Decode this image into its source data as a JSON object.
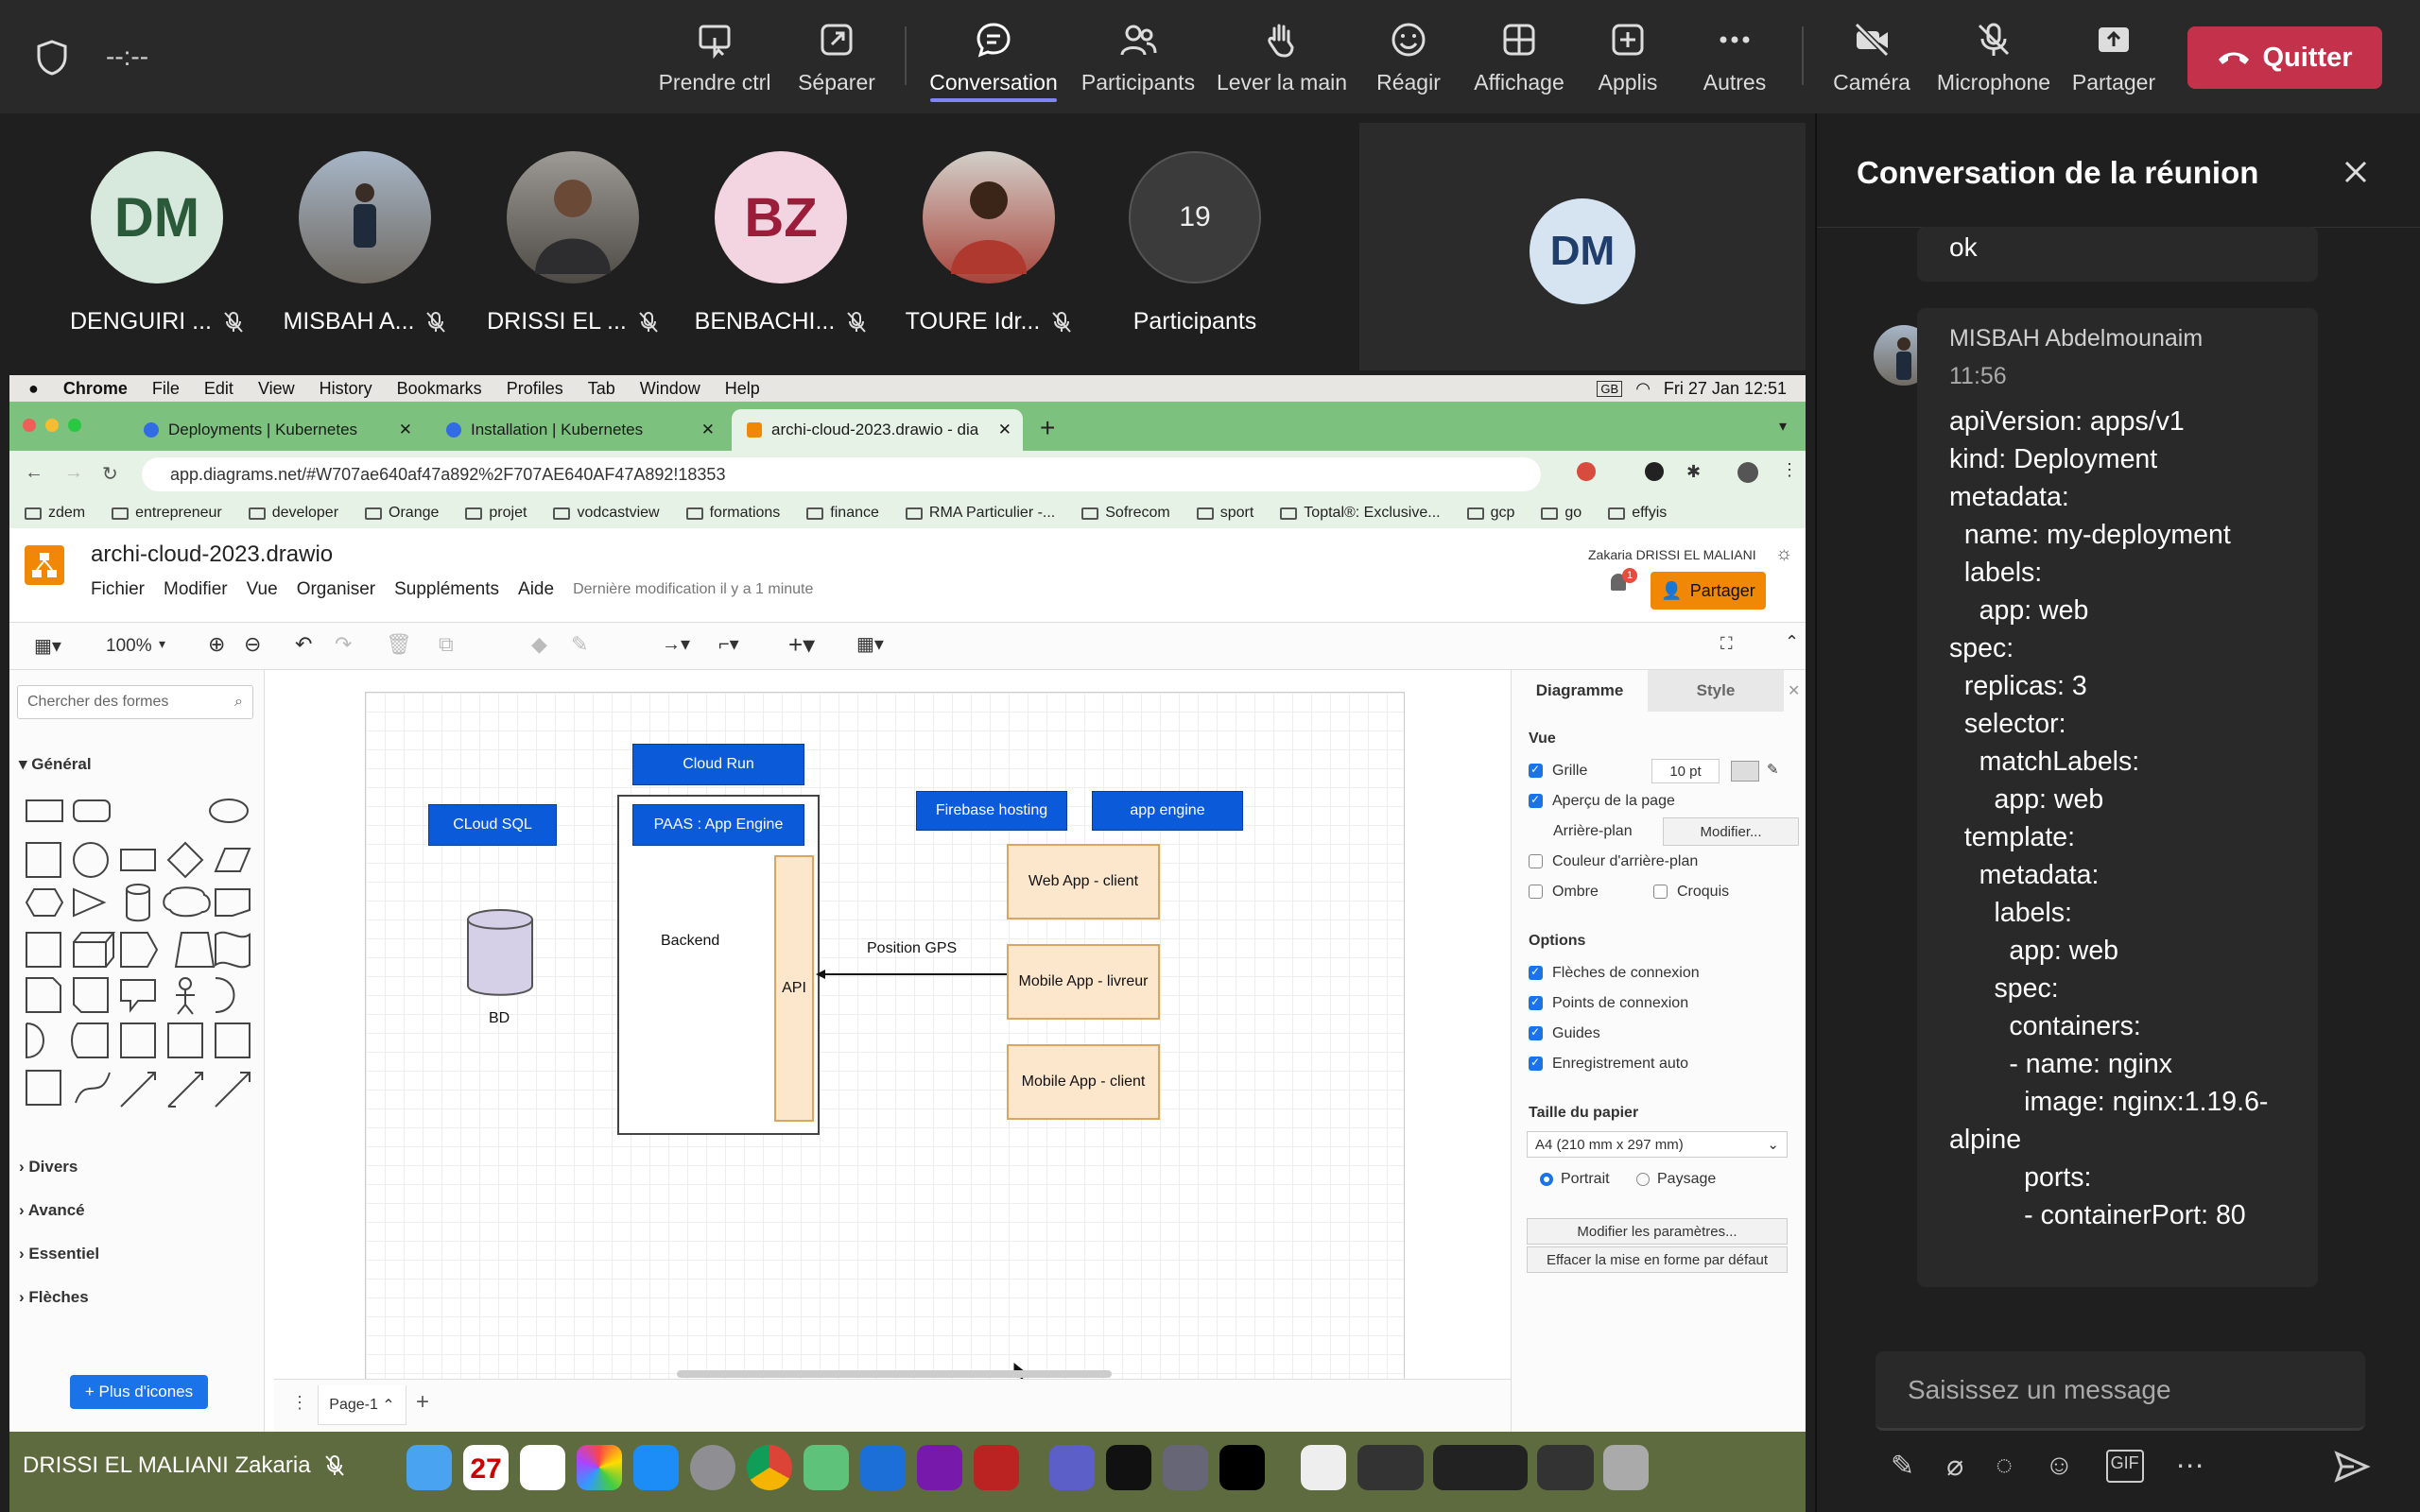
{
  "teams": {
    "timer": "--:--",
    "toolbar": [
      {
        "label": "Prendre ctrl",
        "icon": "take-control-icon"
      },
      {
        "label": "Séparer",
        "icon": "pop-out-icon"
      },
      {
        "label": "Conversation",
        "icon": "chat-icon",
        "active": true
      },
      {
        "label": "Participants",
        "icon": "people-icon"
      },
      {
        "label": "Lever la main",
        "icon": "raise-hand-icon"
      },
      {
        "label": "Réagir",
        "icon": "react-icon"
      },
      {
        "label": "Affichage",
        "icon": "view-icon"
      },
      {
        "label": "Applis",
        "icon": "apps-icon"
      },
      {
        "label": "Autres",
        "icon": "more-icon"
      },
      {
        "label": "Caméra",
        "icon": "camera-off-icon"
      },
      {
        "label": "Microphone",
        "icon": "mic-off-icon"
      },
      {
        "label": "Partager",
        "icon": "share-icon"
      }
    ],
    "quit": "Quitter",
    "accent": "#7f85f5",
    "quit_color": "#c4314b"
  },
  "participants": {
    "tiles": [
      {
        "initials": "DM",
        "name": "DENGUIRI ...",
        "bg": "#d6e9dc",
        "fg": "#2b5a3b"
      },
      {
        "initials": "",
        "name": "MISBAH A...",
        "bg": "#8a9bb0"
      },
      {
        "initials": "",
        "name": "DRISSI EL ...",
        "bg": "#6c6258"
      },
      {
        "initials": "BZ",
        "name": "BENBACHI...",
        "bg": "#f3d5e1",
        "fg": "#9b1d3a"
      },
      {
        "initials": "",
        "name": "TOURE Idr...",
        "bg": "#b3544a"
      }
    ],
    "count": "19",
    "count_label": "Participants",
    "big_initials": "DM"
  },
  "screen": {
    "mac": {
      "apple": "",
      "app": "Chrome",
      "menu": [
        "File",
        "Edit",
        "View",
        "History",
        "Bookmarks",
        "Profiles",
        "Tab",
        "Window",
        "Help"
      ],
      "date": "Fri 27 Jan  12:51",
      "keyboard": "GB"
    },
    "tabs": [
      "Deployments | Kubernetes",
      "Installation | Kubernetes",
      "archi-cloud-2023.drawio - diag"
    ],
    "url": "app.diagrams.net/#W707ae640af47a892%2F707AE640AF47A892!18353",
    "bookmarks": [
      "zdem",
      "entrepreneur",
      "developer",
      "Orange",
      "projet",
      "vodcastview",
      "formations",
      "finance",
      "RMA Particulier -...",
      "Sofrecom",
      "sport",
      "Toptal®: Exclusive...",
      "gcp",
      "go",
      "effyis"
    ],
    "drawio": {
      "filename": "archi-cloud-2023.drawio",
      "menu": [
        "Fichier",
        "Modifier",
        "Vue",
        "Organiser",
        "Suppléments",
        "Aide"
      ],
      "last_modified": "Dernière modification il y a 1 minute",
      "user": "Zakaria DRISSI EL MALIANI",
      "share": "Partager",
      "notif_count": "1",
      "zoom": "100%",
      "search_placeholder": "Chercher des formes",
      "section_general": "Général",
      "sections": [
        "Divers",
        "Avancé",
        "Essentiel",
        "Flèches"
      ],
      "more_shapes": "+ Plus d'icones",
      "page_tab": "Page-1",
      "panel_tabs": [
        "Diagramme",
        "Style"
      ],
      "vue": "Vue",
      "grille": "Grille",
      "grid_size": "10 pt",
      "apercu": "Aperçu de la page",
      "arriere_plan": "Arrière-plan",
      "modifier": "Modifier...",
      "couleur": "Couleur d'arrière-plan",
      "ombre": "Ombre",
      "croquis": "Croquis",
      "options": "Options",
      "opt_items": [
        "Flèches de connexion",
        "Points de connexion",
        "Guides",
        "Enregistrement auto"
      ],
      "taille": "Taille du papier",
      "paper": "A4 (210 mm x 297 mm)",
      "portrait": "Portrait",
      "paysage": "Paysage",
      "btn_params": "Modifier les paramètres...",
      "btn_reset": "Effacer la mise en forme par défaut"
    },
    "diagram": {
      "cloud_run": "Cloud Run",
      "cloud_sql": "CLoud SQL",
      "paas": "PAAS : App Engine",
      "firebase": "Firebase hosting",
      "app_engine": "app engine",
      "backend": "Backend",
      "api": "API",
      "bd": "BD",
      "gps": "Position GPS",
      "web_client": "Web App - client",
      "mobile_livreur": "Mobile App - livreur",
      "mobile_client": "Mobile App - client"
    },
    "presenter": "DRISSI EL MALIANI Zakaria",
    "dock_date": "27",
    "dock_month": "JAN"
  },
  "chat": {
    "title": "Conversation de la réunion",
    "prev_msg": "ok",
    "author": "MISBAH Abdelmounaim",
    "time": "11:56",
    "code": "apiVersion: apps/v1\nkind: Deployment\nmetadata:\n  name: my-deployment\n  labels:\n    app: web\nspec:\n  replicas: 3\n  selector:\n    matchLabels:\n      app: web\n  template:\n    metadata:\n      labels:\n        app: web\n      spec:\n        containers:\n        - name: nginx\n          image: nginx:1.19.6-\nalpine\n          ports:\n          - containerPort: 80",
    "input_placeholder": "Saisissez un message"
  }
}
